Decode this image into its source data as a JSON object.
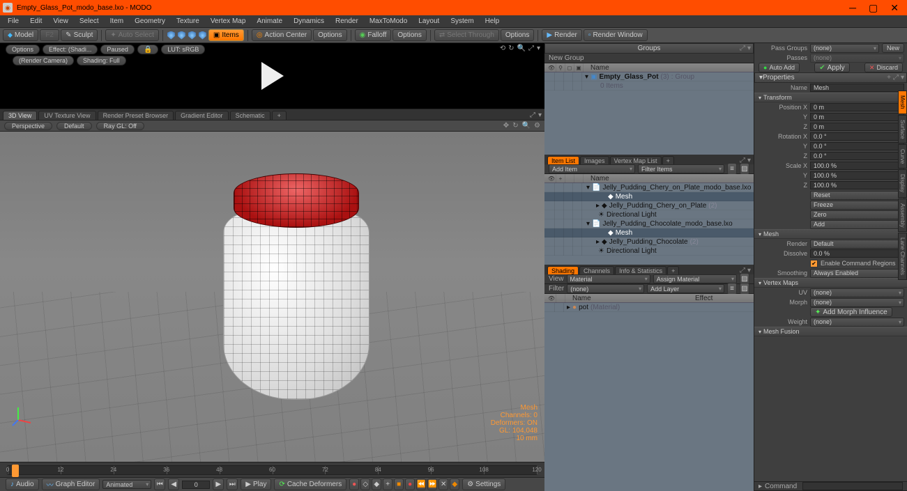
{
  "title": "Empty_Glass_Pot_modo_base.lxo - MODO",
  "menus": [
    "File",
    "Edit",
    "View",
    "Select",
    "Item",
    "Geometry",
    "Texture",
    "Vertex Map",
    "Animate",
    "Dynamics",
    "Render",
    "MaxToModo",
    "Layout",
    "System",
    "Help"
  ],
  "toolbar": {
    "model": "Model",
    "f2": "F2",
    "sculpt": "Sculpt",
    "autoselect": "Auto Select",
    "items": "Items",
    "action_center": "Action Center",
    "options": "Options",
    "falloff": "Falloff",
    "select_through": "Select Through",
    "render": "Render",
    "render_window": "Render Window"
  },
  "preview": {
    "options": "Options",
    "effect": "Effect: (Shadi...",
    "paused": "Paused",
    "lut": "LUT: sRGB",
    "camera": "(Render Camera)",
    "shading": "Shading: Full"
  },
  "view_tabs": [
    "3D View",
    "UV Texture View",
    "Render Preset Browser",
    "Gradient Editor",
    "Schematic"
  ],
  "viewbar": {
    "perspective": "Perspective",
    "default": "Default",
    "raygl": "Ray GL: Off"
  },
  "stats": {
    "mesh": "Mesh",
    "channels": "Channels: 0",
    "deformers": "Deformers: ON",
    "gl": "GL: 104,048",
    "time": "10 mm"
  },
  "timeline": {
    "ticks": [
      0,
      12,
      24,
      36,
      48,
      60,
      72,
      84,
      96,
      108,
      120
    ]
  },
  "playbar": {
    "audio": "Audio",
    "graph": "Graph Editor",
    "animated": "Animated",
    "frame": "0",
    "play": "Play",
    "cache": "Cache Deformers",
    "settings": "Settings"
  },
  "groups": {
    "title": "Groups",
    "new_group": "New Group",
    "name": "Name",
    "item": "Empty_Glass_Pot",
    "count": "(3)",
    "type": ": Group",
    "sub": "0 Items"
  },
  "itemlist": {
    "tabs": [
      "Item List",
      "Images",
      "Vertex Map List"
    ],
    "add_item": "Add Item",
    "filter": "Filter Items",
    "name": "Name",
    "rows": [
      {
        "ind": 0,
        "t": "▾",
        "ic": "📄",
        "label": "Jelly_Pudding_Chery_on_Plate_modo_base.lxo"
      },
      {
        "ind": 2,
        "t": "",
        "ic": "◆",
        "label": "Mesh",
        "sel": true
      },
      {
        "ind": 1,
        "t": "▸",
        "ic": "◆",
        "label": "Jelly_Pudding_Chery_on_Plate",
        "suf": "(2)"
      },
      {
        "ind": 1,
        "t": "",
        "ic": "☀",
        "label": "Directional Light"
      },
      {
        "ind": 0,
        "t": "▾",
        "ic": "📄",
        "label": "Jelly_Pudding_Chocolate_modo_base.lxo"
      },
      {
        "ind": 2,
        "t": "",
        "ic": "◆",
        "label": "Mesh",
        "sel": true
      },
      {
        "ind": 1,
        "t": "▸",
        "ic": "◆",
        "label": "Jelly_Pudding_Chocolate",
        "suf": "(2)"
      },
      {
        "ind": 1,
        "t": "",
        "ic": "☀",
        "label": "Directional Light"
      }
    ]
  },
  "shading": {
    "tabs": [
      "Shading",
      "Channels",
      "Info & Statistics"
    ],
    "view": "View",
    "material": "Material",
    "assign": "Assign Material",
    "filter": "Filter",
    "none": "(none)",
    "add_layer": "Add Layer",
    "name": "Name",
    "effect": "Effect",
    "pot": "pot",
    "pot_type": "(Material)"
  },
  "props": {
    "pass_groups": "Pass Groups",
    "none": "(none)",
    "new": "New",
    "passes": "Passes",
    "auto_add": "Auto Add",
    "apply": "Apply",
    "discard": "Discard",
    "properties": "Properties",
    "name_label": "Name",
    "name_value": "Mesh",
    "transform": "Transform",
    "position": "Position X",
    "pos_y": "Y",
    "pos_z": "Z",
    "pos_val": "0 m",
    "rotation": "Rotation X",
    "rot_val": "0.0 °",
    "scale": "Scale X",
    "scale_val": "100.0 %",
    "reset": "Reset",
    "freeze": "Freeze",
    "zero": "Zero",
    "add": "Add",
    "mesh": "Mesh",
    "render": "Render",
    "default": "Default",
    "dissolve": "Dissolve",
    "dissolve_val": "0.0 %",
    "enable_cmd": "Enable Command Regions",
    "smoothing": "Smoothing",
    "always": "Always Enabled",
    "vertex_maps": "Vertex Maps",
    "uv": "UV",
    "morph": "Morph",
    "add_morph": "Add Morph Influence",
    "weight": "Weight",
    "mesh_fusion": "Mesh Fusion",
    "command": "Command"
  },
  "sidetabs": [
    "Mesh",
    "Surface",
    "Curve",
    "Display",
    "Assembly",
    "Lane Channels"
  ]
}
